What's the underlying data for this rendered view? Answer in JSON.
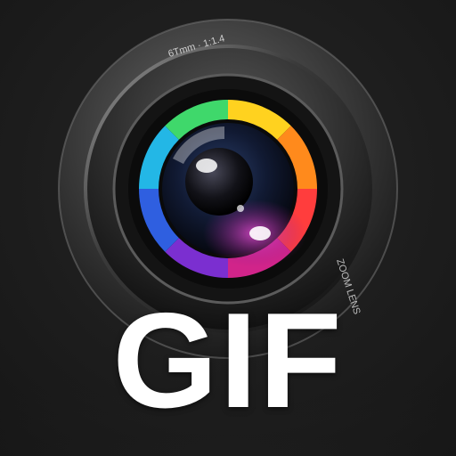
{
  "icon": {
    "label": "GIF",
    "lens_engraving_top": "6Tmm · 1:1.4",
    "lens_engraving_side": "ZOOM LENS"
  },
  "colors": {
    "background": "#1c1c1c",
    "lens_barrel": "#4a4a4a",
    "label": "#ffffff"
  }
}
